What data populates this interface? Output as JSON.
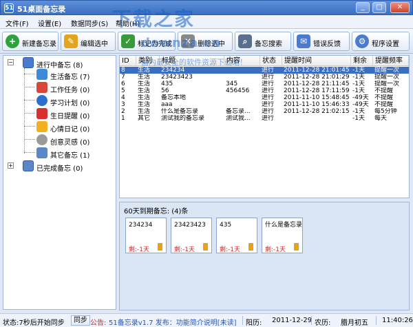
{
  "window": {
    "title": "51桌面备忘录",
    "app_icon": "51"
  },
  "watermark": {
    "line1": "下载之家",
    "line2": "downza.cn",
    "line3": "国内最安全的软件资源下载站！"
  },
  "menu": [
    "文件(F)",
    "设置(E)",
    "数据同步(S)",
    "帮助(H)"
  ],
  "toolbar": [
    {
      "label": "新建备忘录",
      "icon": "add-icon",
      "color": "#2ca33c",
      "glyph": "+"
    },
    {
      "label": "编辑选中",
      "icon": "edit-icon",
      "color": "#e2a51d",
      "glyph": "✎"
    },
    {
      "label": "标记为完成",
      "icon": "check-icon",
      "color": "#3a9a3a",
      "glyph": "✓"
    },
    {
      "label": "删除选中",
      "icon": "delete-icon",
      "color": "#888888",
      "glyph": "✕"
    },
    {
      "label": "备忘搜索",
      "icon": "search-icon",
      "color": "#5a6f8f",
      "glyph": "⌕"
    },
    {
      "label": "错误反馈",
      "icon": "feedback-icon",
      "color": "#4a7bd0",
      "glyph": "✉"
    },
    {
      "label": "程序设置",
      "icon": "settings-icon",
      "color": "#4a7bd0",
      "glyph": "⚙"
    }
  ],
  "tree": {
    "active": "进行中备忘 (8)",
    "children": [
      {
        "label": "生活备忘 (7)",
        "icon": "house-icon",
        "color": "#3d8bd8"
      },
      {
        "label": "工作任务 (0)",
        "icon": "chart-icon",
        "color": "#d8483a"
      },
      {
        "label": "学习计划 (0)",
        "icon": "help-icon",
        "color": "#2b6fcf"
      },
      {
        "label": "生日提醒 (0)",
        "icon": "gift-icon",
        "color": "#d82f2f"
      },
      {
        "label": "心情日记 (0)",
        "icon": "lightning-icon",
        "color": "#f0b020"
      },
      {
        "label": "创意灵感 (0)",
        "icon": "bulb-icon",
        "color": "#9a9a9a"
      },
      {
        "label": "其它备忘 (1)",
        "icon": "note-icon",
        "color": "#5b87c8"
      }
    ],
    "done": "已完成备忘 (0)"
  },
  "list": {
    "columns": [
      "ID",
      "类别",
      "标题",
      "内容",
      "状态",
      "提醒时间",
      "剩余",
      "提醒频率"
    ],
    "rows": [
      {
        "id": "8",
        "cat": "生活",
        "title": "234234",
        "content": "",
        "status": "进行",
        "time": "2011-12-28 21:01:45",
        "left": "-1天",
        "freq": "提醒一次",
        "selected": true
      },
      {
        "id": "7",
        "cat": "生活",
        "title": "23423423",
        "content": "",
        "status": "进行",
        "time": "2011-12-28 21:01:29",
        "left": "-1天",
        "freq": "提醒一次",
        "selected": false
      },
      {
        "id": "6",
        "cat": "生活",
        "title": "435",
        "content": "345",
        "status": "进行",
        "time": "2011-12-28 21:11:45",
        "left": "-1天",
        "freq": "提醒一次",
        "selected": false
      },
      {
        "id": "5",
        "cat": "生活",
        "title": "56",
        "content": "456456",
        "status": "进行",
        "time": "2011-12-28 17:11:59",
        "left": "-1天",
        "freq": "不提醒",
        "selected": false
      },
      {
        "id": "4",
        "cat": "生活",
        "title": "备忘本地",
        "content": "",
        "status": "进行",
        "time": "2011-11-10 15:48:45",
        "left": "-49天",
        "freq": "不提醒",
        "selected": false
      },
      {
        "id": "3",
        "cat": "生活",
        "title": "aaa",
        "content": "",
        "status": "进行",
        "time": "2011-11-10 15:46:33",
        "left": "-49天",
        "freq": "不提醒",
        "selected": false
      },
      {
        "id": "2",
        "cat": "生活",
        "title": "什么是备忘录",
        "content": "备忘录...",
        "status": "进行",
        "time": "2011-12-28 21:02:15",
        "left": "-1天",
        "freq": "每5分钟",
        "selected": false
      },
      {
        "id": "1",
        "cat": "其它",
        "title": "测试我的备忘录",
        "content": "测试我...",
        "status": "进行",
        "time": "",
        "left": "-1天",
        "freq": "每天",
        "selected": false
      }
    ]
  },
  "expire": {
    "title": "60天到期备忘: (4)条",
    "cards": [
      {
        "title": "234234",
        "remain": "剩:-1天"
      },
      {
        "title": "23423423",
        "remain": "剩:-1天"
      },
      {
        "title": "435",
        "remain": "剩:-1天"
      },
      {
        "title": "什么是备忘录",
        "remain": "剩:-1天"
      }
    ]
  },
  "status": {
    "sync_text": "状态:7秒后开始同步",
    "sync_button": "同步",
    "ad_label": "公告:",
    "ad_text": "51备忘录v1.7 发布：功能简介说明[未读]",
    "solar_label": "阳历:",
    "solar_date": "2011-12-29",
    "lunar_label": "农历:",
    "lunar_date": "腊月初五",
    "time": "11:40:26"
  }
}
